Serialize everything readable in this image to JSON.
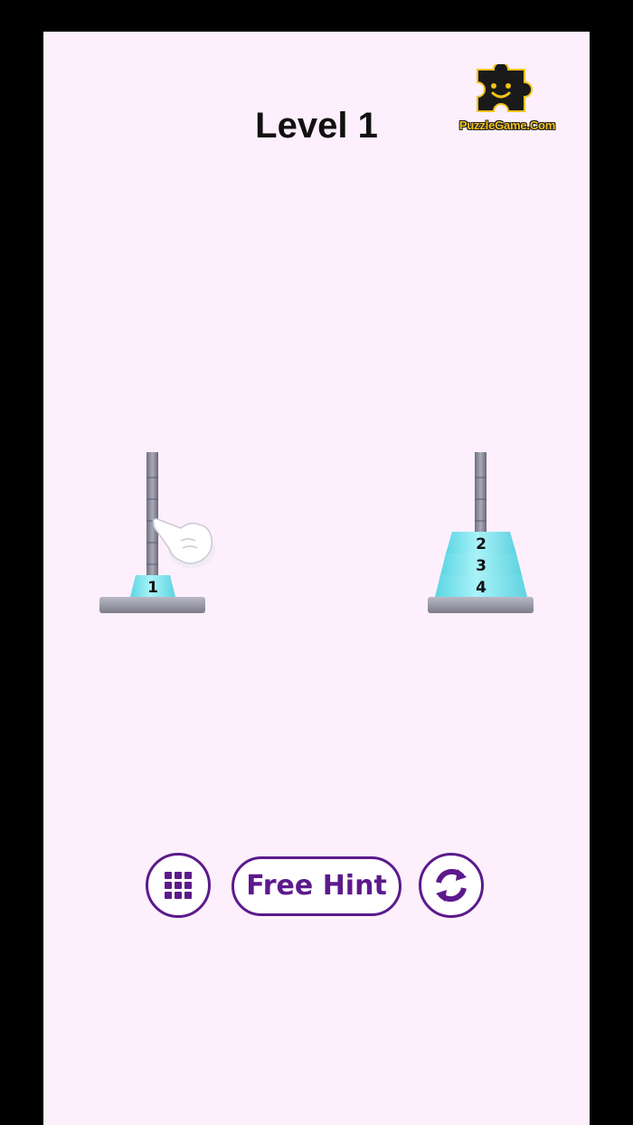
{
  "header": {
    "level_title": "Level 1"
  },
  "logo": {
    "text": "PuzzleGame.Com",
    "colors": {
      "fill": "#f2c21b",
      "puzzle_piece": "#1a1a1a"
    }
  },
  "game": {
    "towers": [
      {
        "name": "left",
        "disks": [
          "1"
        ]
      },
      {
        "name": "right",
        "disks": [
          "2",
          "3",
          "4"
        ]
      }
    ],
    "disk_color": "#7ee6f0",
    "hint_pointer": "hand-pointer-icon"
  },
  "controls": {
    "menu_icon": "grid-icon",
    "hint_label": "Free Hint",
    "restart_icon": "restart-icon",
    "accent": "#5c1a8c"
  },
  "colors": {
    "background": "#fdf0fc",
    "frame": "#000000"
  }
}
